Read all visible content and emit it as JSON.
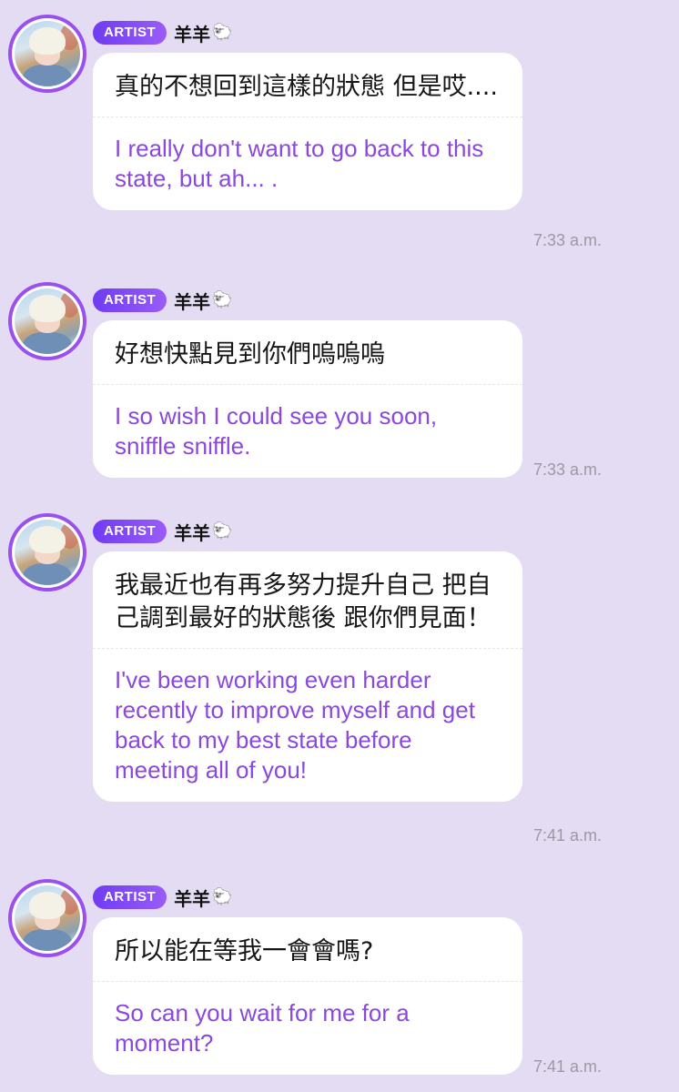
{
  "messages": [
    {
      "badge": "ARTIST",
      "name": "羊羊",
      "name_icon": "sheep-emoji",
      "original": "真的不想回到這樣的狀態 但是哎....",
      "translation": "I really don't want to go back to this state, but ah... .",
      "time": "7:33 a.m."
    },
    {
      "badge": "ARTIST",
      "name": "羊羊",
      "name_icon": "sheep-emoji",
      "original": "好想快點見到你們嗚嗚嗚",
      "translation": "I so wish I could see you soon, sniffle sniffle.",
      "time": "7:33 a.m."
    },
    {
      "badge": "ARTIST",
      "name": "羊羊",
      "name_icon": "sheep-emoji",
      "original": "我最近也有再多努力提升自己 把自己調到最好的狀態後 跟你們見面！",
      "translation": "I've been working even harder recently to improve myself and get back to my best state before meeting all of you!",
      "time": "7:41 a.m."
    },
    {
      "badge": "ARTIST",
      "name": "羊羊",
      "name_icon": "sheep-emoji",
      "original": "所以能在等我一會會嗎?",
      "translation": "So can you wait for me for a moment?",
      "time": "7:41 a.m."
    }
  ],
  "colors": {
    "background": "#e4dcf2",
    "badge": "#7a45f3",
    "translation_text": "#8a48dc",
    "avatar_ring": "#9a4ff0"
  }
}
